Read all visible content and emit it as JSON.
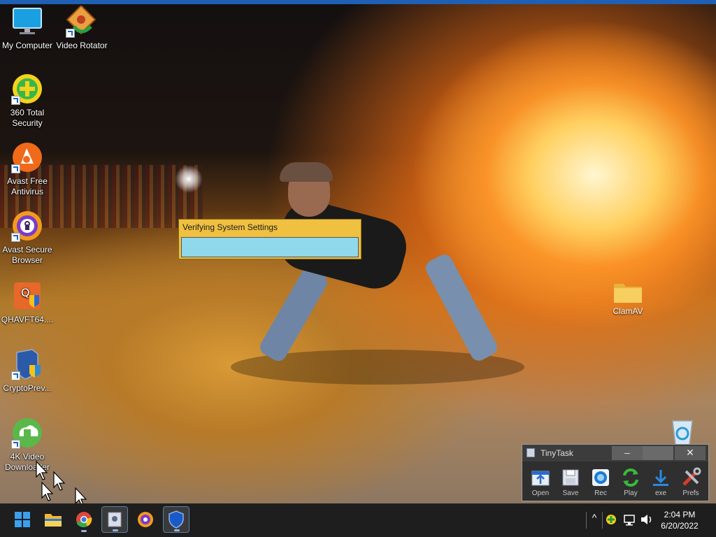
{
  "desktop": {
    "icons": [
      {
        "label": "My Computer",
        "icon": "monitor-icon"
      },
      {
        "label": "Video Rotator",
        "icon": "video-rotator-icon"
      },
      {
        "label": "360 Total Security",
        "icon": "360-security-icon"
      },
      {
        "label": "Avast Free Antivirus",
        "icon": "avast-antivirus-icon"
      },
      {
        "label": "Avast Secure Browser",
        "icon": "avast-browser-icon"
      },
      {
        "label": "QHAVFT64....",
        "icon": "qh-shield-icon"
      },
      {
        "label": "CryptoPrev...",
        "icon": "crypto-shield-icon"
      },
      {
        "label": "4K Video Downloader",
        "icon": "4k-downloader-icon"
      },
      {
        "label": "ClamAV",
        "icon": "folder-icon"
      }
    ]
  },
  "dialog": {
    "title": "Verifying System Settings",
    "progress": 1.0
  },
  "tinytask": {
    "title": "TinyTask",
    "minimize": "–",
    "close": "✕",
    "buttons": [
      {
        "label": "Open",
        "icon": "open-icon"
      },
      {
        "label": "Save",
        "icon": "save-icon"
      },
      {
        "label": "Rec",
        "icon": "record-icon"
      },
      {
        "label": "Play",
        "icon": "play-loop-icon"
      },
      {
        "label": "exe",
        "icon": "download-exe-icon"
      },
      {
        "label": "Prefs",
        "icon": "prefs-tools-icon"
      }
    ]
  },
  "taskbar": {
    "tray_chevron": "^",
    "time": "2:04 PM",
    "date": "6/20/2022"
  },
  "colors": {
    "accent": "#1f5fb4",
    "dialog_bg": "#f0c040",
    "progress": "#90d8ec"
  }
}
